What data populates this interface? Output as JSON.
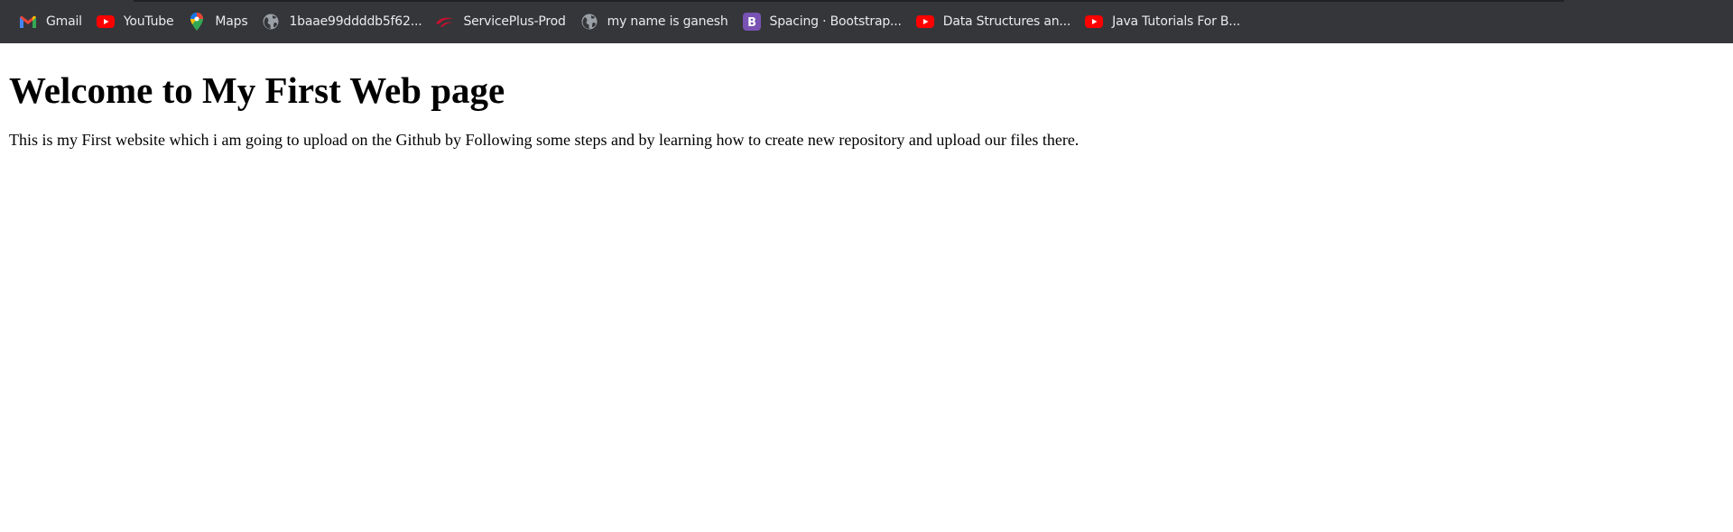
{
  "bookmarks": [
    {
      "label": "Gmail",
      "icon": "gmail-icon"
    },
    {
      "label": "YouTube",
      "icon": "youtube-icon"
    },
    {
      "label": "Maps",
      "icon": "maps-icon"
    },
    {
      "label": "1baae99ddddb5f62...",
      "icon": "globe-icon"
    },
    {
      "label": "ServicePlus-Prod",
      "icon": "serviceplus-icon"
    },
    {
      "label": "my name is ganesh",
      "icon": "globe-icon"
    },
    {
      "label": "Spacing · Bootstrap...",
      "icon": "bootstrap-icon"
    },
    {
      "label": "Data Structures an...",
      "icon": "youtube-icon"
    },
    {
      "label": "Java Tutorials For B...",
      "icon": "youtube-icon"
    }
  ],
  "page": {
    "heading": "Welcome to My First Web page",
    "paragraph": "This is my First website which i am going to upload on the Github by Following some steps and by learning how to create new repository and upload our files there."
  },
  "colors": {
    "bookmarks_bar_bg": "#35363a",
    "bookmark_text": "#e8eaed",
    "youtube_red": "#ff0000",
    "bootstrap_purple": "#7952b3",
    "page_bg": "#ffffff"
  }
}
